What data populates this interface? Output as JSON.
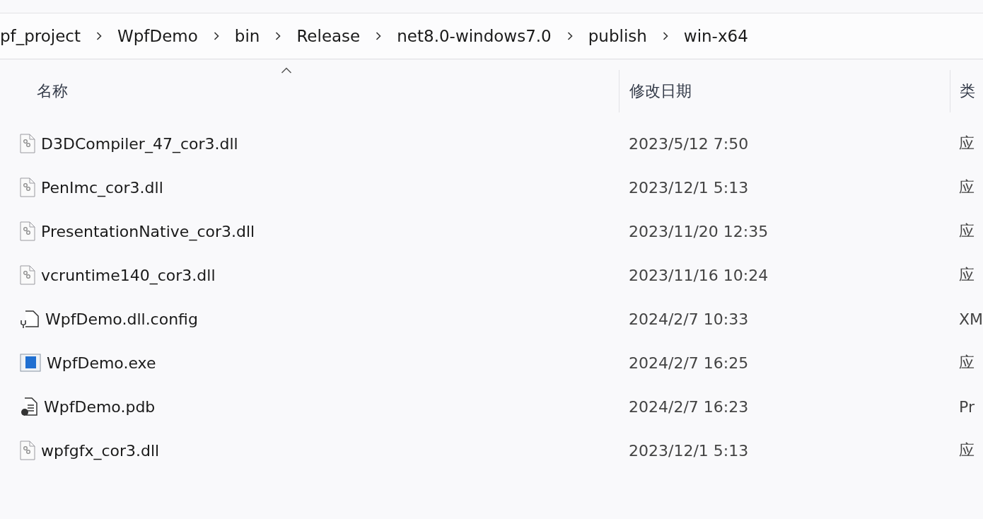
{
  "breadcrumb": [
    "pf_project",
    "WpfDemo",
    "bin",
    "Release",
    "net8.0-windows7.0",
    "publish",
    "win-x64"
  ],
  "columns": [
    {
      "label": "名称",
      "sorted": true
    },
    {
      "label": "修改日期",
      "sorted": false
    },
    {
      "label": "类",
      "sorted": false
    }
  ],
  "rows": [
    {
      "kind": "dll",
      "name": "D3DCompiler_47_cor3.dll",
      "date": "2023/5/12 7:50",
      "type": "应"
    },
    {
      "kind": "dll",
      "name": "PenImc_cor3.dll",
      "date": "2023/12/1 5:13",
      "type": "应"
    },
    {
      "kind": "dll",
      "name": "PresentationNative_cor3.dll",
      "date": "2023/11/20 12:35",
      "type": "应"
    },
    {
      "kind": "dll",
      "name": "vcruntime140_cor3.dll",
      "date": "2023/11/16 10:24",
      "type": "应"
    },
    {
      "kind": "config",
      "name": "WpfDemo.dll.config",
      "date": "2024/2/7 10:33",
      "type": "XM"
    },
    {
      "kind": "exe",
      "name": "WpfDemo.exe",
      "date": "2024/2/7 16:25",
      "type": "应"
    },
    {
      "kind": "pdb",
      "name": "WpfDemo.pdb",
      "date": "2024/2/7 16:23",
      "type": "Pr"
    },
    {
      "kind": "dll",
      "name": "wpfgfx_cor3.dll",
      "date": "2023/12/1 5:13",
      "type": "应"
    }
  ]
}
